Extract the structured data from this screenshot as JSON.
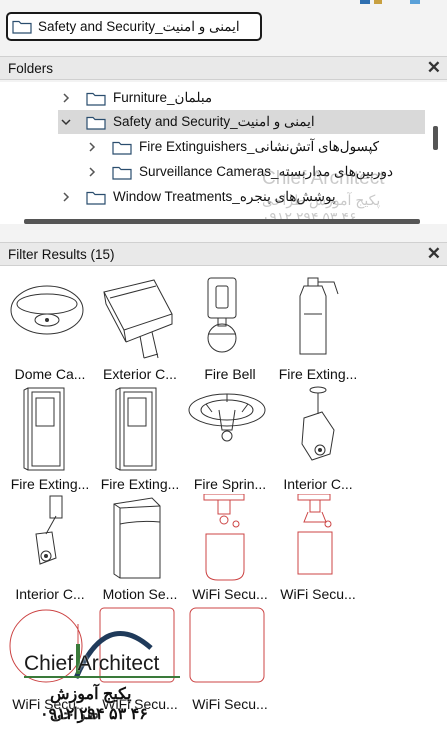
{
  "top_strip_colors": [
    "#2f6fb0",
    "#c8a040",
    "#5aa0d8"
  ],
  "path": {
    "label": "Safety and Security_ایمنی و امنیت"
  },
  "folders_panel": {
    "title": "Folders",
    "close": "✕",
    "items": [
      {
        "label": "Furniture_مبلمان",
        "expanded": false,
        "selected": false
      },
      {
        "label": "Safety and Security_ایمنی و امنیت",
        "expanded": true,
        "selected": true
      },
      {
        "label": "Fire Extinguishers_کپسول‌های آتش‌نشانی",
        "expanded": false,
        "selected": false
      },
      {
        "label": "Surveillance Cameras_دوربین‌های مداربسته",
        "expanded": false,
        "selected": false
      },
      {
        "label": "Window Treatments_پوشش‌های پنجره",
        "expanded": false,
        "selected": false
      }
    ]
  },
  "results_panel": {
    "title": "Filter Results (15)",
    "close": "✕",
    "items": [
      {
        "label": "Dome Ca...",
        "icon": "dome-camera"
      },
      {
        "label": "Exterior C...",
        "icon": "exterior-camera"
      },
      {
        "label": "Fire Bell",
        "icon": "fire-bell"
      },
      {
        "label": "Fire Exting...",
        "icon": "fire-extinguisher"
      },
      {
        "label": "Fire Exting...",
        "icon": "extinguisher-cabinet"
      },
      {
        "label": "Fire Exting...",
        "icon": "extinguisher-cabinet"
      },
      {
        "label": "Fire Sprin...",
        "icon": "fire-sprinkler"
      },
      {
        "label": "Interior C...",
        "icon": "interior-camera"
      },
      {
        "label": "Interior C...",
        "icon": "interior-camera-wall"
      },
      {
        "label": "Motion Se...",
        "icon": "motion-sensor"
      },
      {
        "label": "WiFi Secu...",
        "icon": "wifi-camera"
      },
      {
        "label": "WiFi Secu...",
        "icon": "wifi-camera"
      },
      {
        "label": "WiFi Secu...",
        "icon": "wifi-camera-round"
      },
      {
        "label": "WiFi Secu...",
        "icon": "wifi-camera-square"
      },
      {
        "label": "WiFi Secu...",
        "icon": "wifi-camera-square"
      }
    ]
  },
  "watermark": {
    "brand": "Chief Architect",
    "tagline": "پکیج آموزش طراحی",
    "phone": "۰۹۱۲ ۲۹۴ ۵۳ ۴۶"
  }
}
